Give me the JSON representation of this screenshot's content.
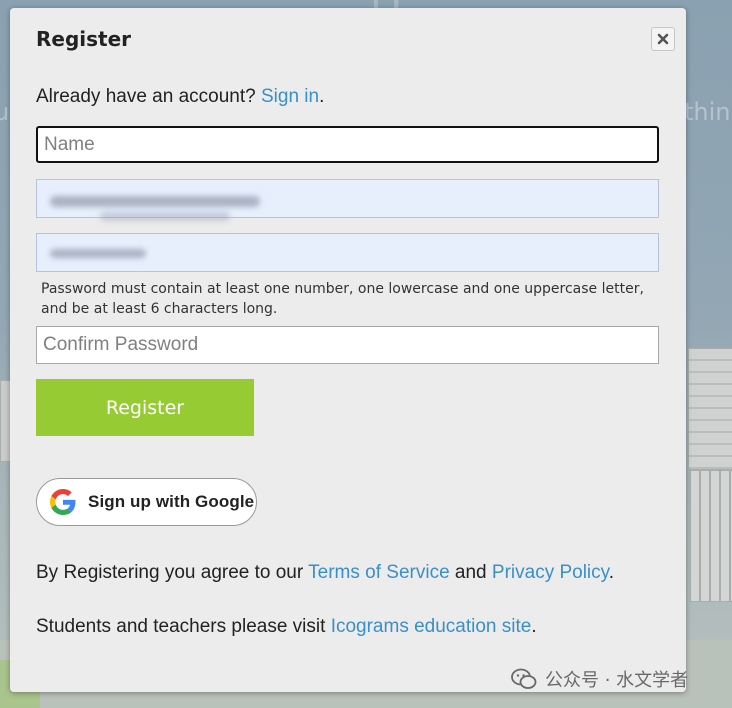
{
  "background": {
    "left_text": "u",
    "right_text": "thin",
    "top_text": "D"
  },
  "modal": {
    "title": "Register",
    "close_label": "close"
  },
  "signin": {
    "prefix": "Already have an account? ",
    "link": "Sign in",
    "suffix": "."
  },
  "form": {
    "name_placeholder": "Name",
    "email_value": "",
    "password_value": "",
    "password_hint": "Password must contain at least one number, one lowercase and one uppercase letter, and be at least 6 characters long.",
    "confirm_placeholder": "Confirm Password"
  },
  "buttons": {
    "register": "Register",
    "google": "Sign up with Google"
  },
  "terms": {
    "prefix": "By Registering you agree to our ",
    "tos_link": "Terms of Service",
    "middle": " and ",
    "privacy_link": "Privacy Policy",
    "suffix": "."
  },
  "education": {
    "prefix": "Students and teachers please visit ",
    "link": "Icograms education site",
    "suffix": "."
  },
  "watermark": {
    "text": "公众号 · 水文学者"
  },
  "colors": {
    "accent_green": "#96cb34",
    "link_blue": "#3a8fc9",
    "autofill_blue": "#e7effd"
  },
  "icons": {
    "close": "close-icon",
    "google": "google-g-icon",
    "wechat": "wechat-icon"
  }
}
